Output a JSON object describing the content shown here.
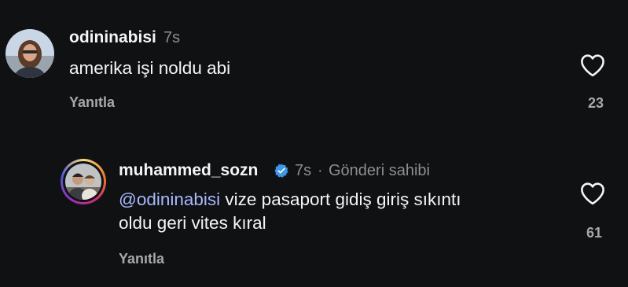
{
  "comments": [
    {
      "username": "odininabisi",
      "time": "7s",
      "text": "amerika işi noldu abi",
      "reply_label": "Yanıtla",
      "likes": "23",
      "verified": false,
      "icons": {
        "like": "heart-outline-icon"
      }
    },
    {
      "username": "muhammed_sozn",
      "time": "7s",
      "separator": "·",
      "author_label": "Gönderi sahibi",
      "mention": "@odininabisi",
      "text_line1": " vize pasaport gidiş giriş sıkıntı",
      "text_line2": "oldu geri vites kıral",
      "reply_label": "Yanıtla",
      "likes": "61",
      "verified": true,
      "icons": {
        "like": "heart-outline-icon",
        "badge": "verified-badge-icon"
      }
    }
  ],
  "colors": {
    "background": "#0f1113",
    "text": "#f5f5f5",
    "secondary": "#a8a8a8",
    "mention": "#a9b9ff",
    "verified": "#3897f0"
  }
}
